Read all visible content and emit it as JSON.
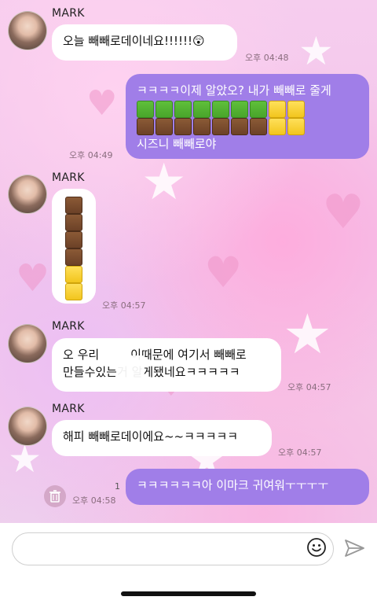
{
  "messages": [
    {
      "sender": "MARK",
      "text": "오늘 빼빼로데이네요!!!!!!😲",
      "time": "오후 04:48"
    },
    {
      "sender": "me",
      "line1": "ㅋㅋㅋㅋ이제 알았오? 내가 빼빼로 줄게",
      "line3": "시즈니 빼빼로야",
      "time": "오후 04:49"
    },
    {
      "sender": "MARK",
      "time": "오후 04:57"
    },
    {
      "sender": "MARK",
      "line1": "오 우리",
      "line1b": "이때문에 여기서 빼빼로",
      "line2": "만들수있는거 알게됐네요ㅋㅋㅋㅋㅋ",
      "time": "오후 04:57"
    },
    {
      "sender": "MARK",
      "text": "해피 빼빼로데이에요~~ㅋㅋㅋㅋㅋ",
      "time": "오후 04:57"
    },
    {
      "sender": "me",
      "text": "ㅋㅋㅋㅋㅋㅋ아 이마크 귀여워ㅜㅜㅜㅜ",
      "time": "오후 04:58",
      "unread": "1"
    }
  ],
  "icons": {
    "emoji": "smiley-icon",
    "send": "send-icon",
    "trash": "trash-icon"
  },
  "colors": {
    "my_bubble": "#a07ee8",
    "their_bubble": "#ffffff"
  }
}
